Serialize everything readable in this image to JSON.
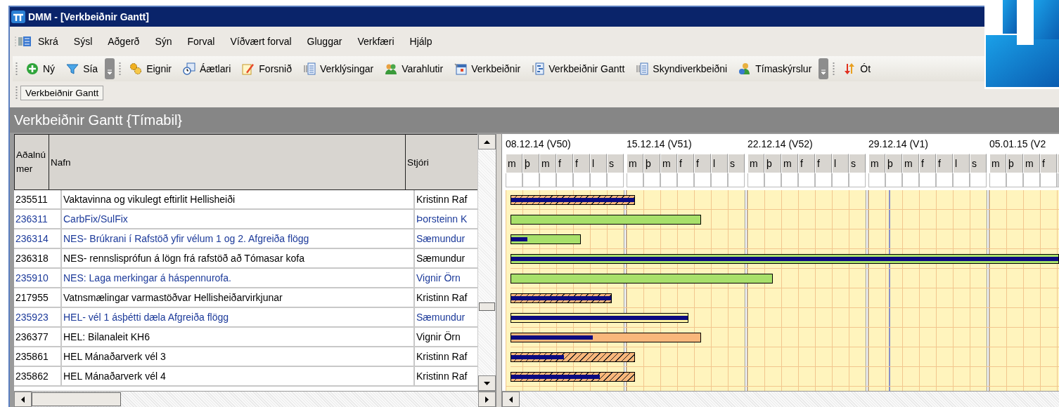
{
  "window": {
    "title": "DMM - [Verkbeiðnir Gantt]"
  },
  "menu": [
    "Skrá",
    "Sýsl",
    "Aðgerð",
    "Sýn",
    "Forval",
    "Víðvært forval",
    "Gluggar",
    "Verkfæri",
    "Hjálp"
  ],
  "toolbar": {
    "groups": [
      [
        "Ný",
        "Sía"
      ],
      [
        "Eignir",
        "Áætlari",
        "Forsnið",
        "Verklýsingar",
        "Varahlutir",
        "Verkbeiðnir",
        "Verkbeiðnir Gantt",
        "Skyndiverkbeiðni",
        "Tímaskýrslur"
      ],
      [
        "Ót"
      ]
    ]
  },
  "open_windows": [
    "Verkbeiðnir Gantt"
  ],
  "panel": {
    "title": "Verkbeiðnir Gantt {Tímabil}"
  },
  "table": {
    "columns": [
      "Aðalnúmer",
      "Nafn",
      "Stjóri"
    ],
    "rows": [
      {
        "id": "235511",
        "name": "Vaktavinna og vikulegt eftirlit Hellisheiði",
        "manager": "Kristinn Raf",
        "highlighted": false,
        "bar": {
          "kind": "hatched",
          "color": "#f9b77b",
          "level": 0.227
        },
        "progress": {
          "level": 1
        }
      },
      {
        "id": "236311",
        "name": "CarbFix/SulFix",
        "manager": "Þorsteinn K",
        "highlighted": true,
        "bar": {
          "kind": "solid",
          "color": "#a8e06a",
          "level": 0.347
        }
      },
      {
        "id": "236314",
        "name": "NES- Brúkrani í Rafstöð yfir vélum 1 og 2. Afgreiða flögg",
        "manager": "Sæmundur",
        "highlighted": true,
        "bar": {
          "kind": "solid",
          "color": "#a8e06a",
          "level": 0.128
        },
        "progress": {
          "level": 0.24
        }
      },
      {
        "id": "236318",
        "name": "NES- rennslisprófun á lögn frá rafstöð að Tómasar kofa",
        "manager": "Sæmundur",
        "highlighted": false,
        "bar": {
          "kind": "solid",
          "color": "#a8e06a",
          "level": 1
        },
        "progress": {
          "level": 1
        }
      },
      {
        "id": "235910",
        "name": "NES: Laga merkingar á háspennurofa.",
        "manager": "Vignir Örn",
        "highlighted": true,
        "bar": {
          "kind": "solid",
          "color": "#a8e06a",
          "level": 0.478
        }
      },
      {
        "id": "217955",
        "name": "Vatnsmælingar varmastöðvar Hellisheiðarvirkjunar",
        "manager": "Kristinn Raf",
        "highlighted": false,
        "bar": {
          "kind": "hatched",
          "color": "#f9b77b",
          "level": 0.185
        },
        "progress": {
          "level": 1
        }
      },
      {
        "id": "235923",
        "name": "HEL- vél 1 ásþétti dæla Afgreiða flögg",
        "manager": "Sæmundur",
        "highlighted": true,
        "bar": {
          "kind": "solid",
          "color": "#fff3a0",
          "level": 0.324
        },
        "progress": {
          "level": 1
        }
      },
      {
        "id": "236377",
        "name": "HEL: Bilanaleit KH6",
        "manager": "Vignir Örn",
        "highlighted": false,
        "bar": {
          "kind": "solid",
          "color": "#f9b77b",
          "level": 0.347
        },
        "progress": {
          "level": 0.43
        }
      },
      {
        "id": "235861",
        "name": "HEL Mánaðarverk vél 3",
        "manager": "Kristinn Raf",
        "highlighted": false,
        "bar": {
          "kind": "hatched",
          "color": "#f9b77b",
          "level": 0.227
        },
        "progress": {
          "level": 0.43
        }
      },
      {
        "id": "235862",
        "name": "HEL Mánaðarverk vél 4",
        "manager": "Kristinn Raf",
        "highlighted": false,
        "bar": {
          "kind": "hatched",
          "color": "#f9b77b",
          "level": 0.227
        },
        "progress": {
          "level": 0.72
        }
      }
    ]
  },
  "gantt": {
    "weeks": [
      {
        "label": "08.12.14 (V50)",
        "days": [
          "m",
          "þ",
          "m",
          "f",
          "f",
          "l",
          "s"
        ]
      },
      {
        "label": "15.12.14 (V51)",
        "days": [
          "m",
          "þ",
          "m",
          "f",
          "f",
          "l",
          "s"
        ]
      },
      {
        "label": "22.12.14 (V52)",
        "days": [
          "m",
          "þ",
          "m",
          "f",
          "f",
          "l",
          "s"
        ]
      },
      {
        "label": "29.12.14 (V1)",
        "days": [
          "m",
          "þ",
          "m",
          "f",
          "f",
          "l",
          "s"
        ]
      },
      {
        "label": "05.01.15 (V2",
        "days": [
          "m",
          "þ",
          "m",
          "f"
        ]
      }
    ]
  }
}
